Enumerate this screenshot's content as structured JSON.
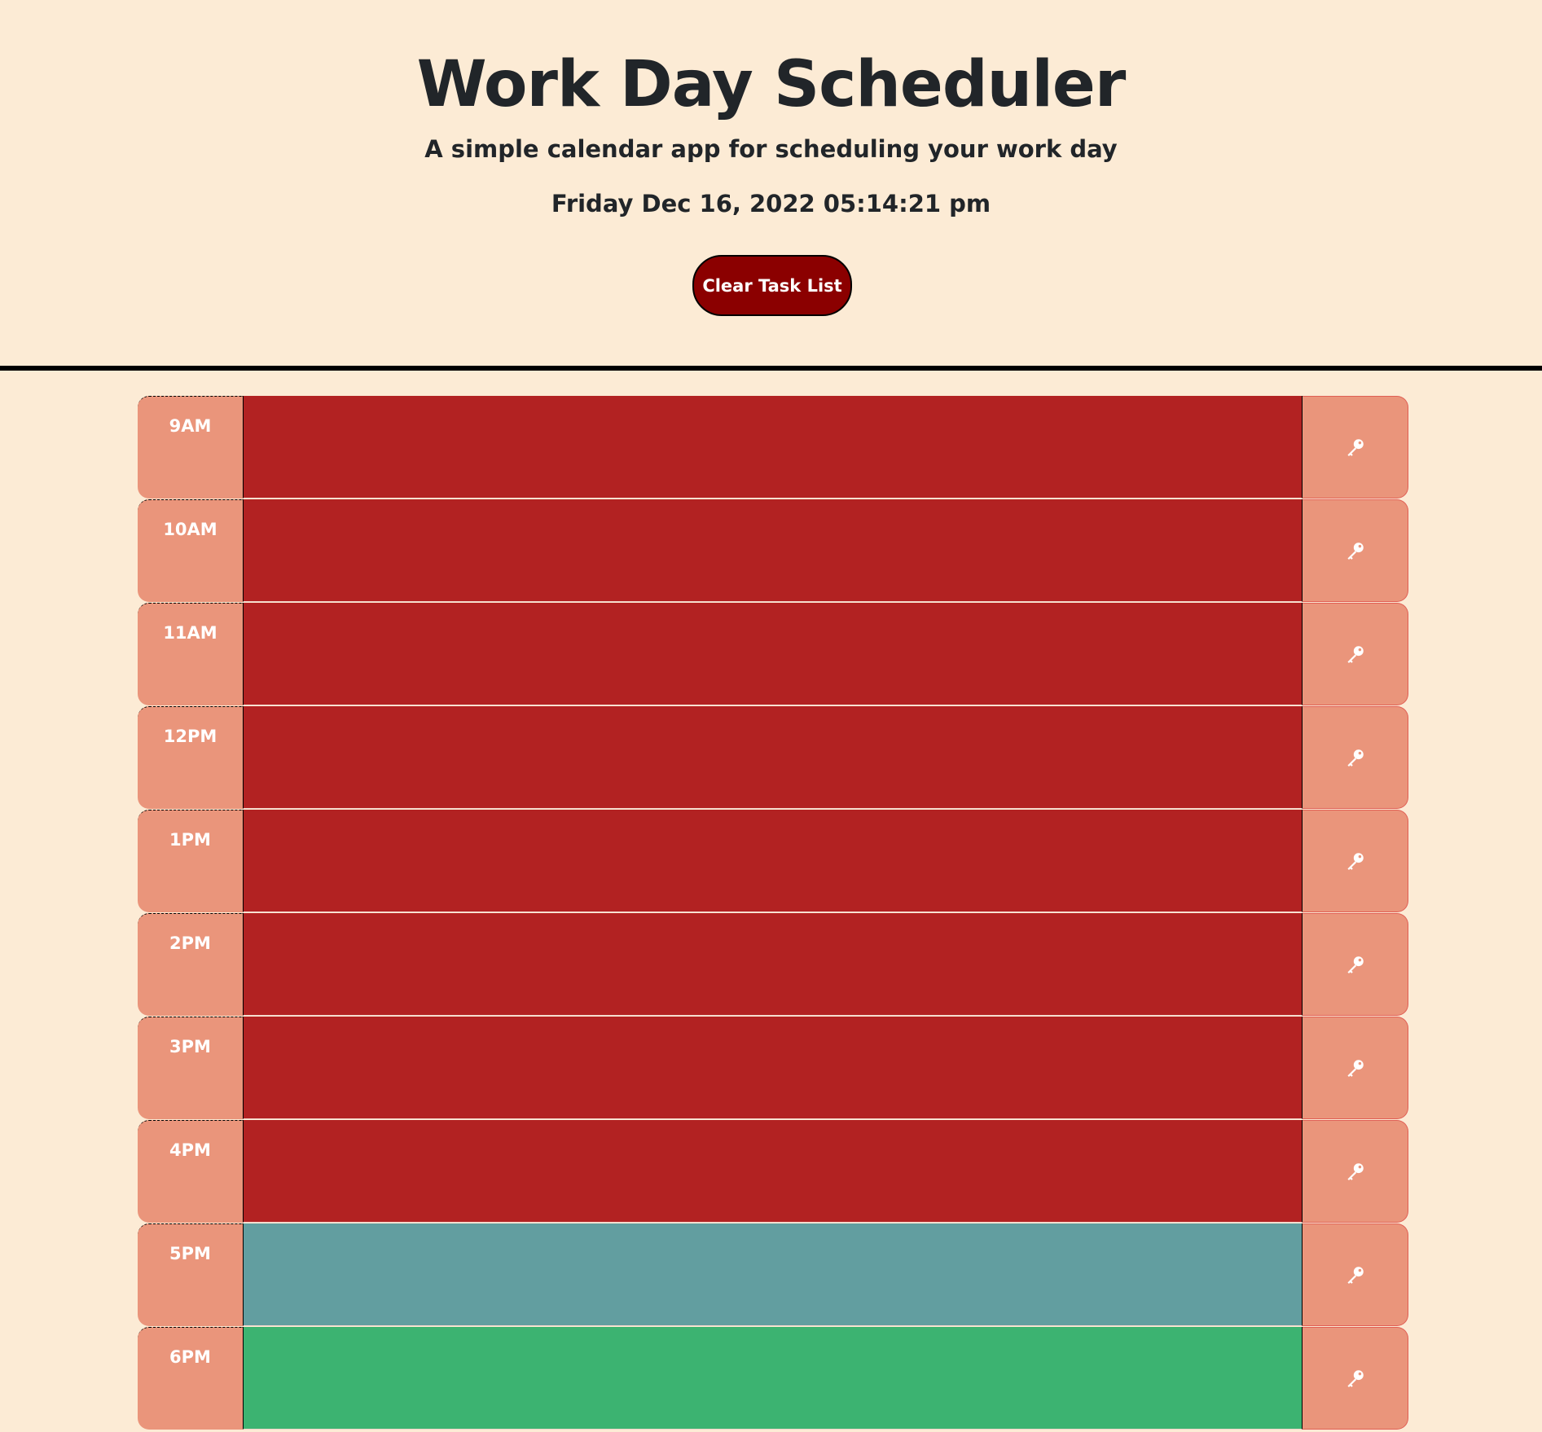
{
  "header": {
    "title": "Work Day Scheduler",
    "subtitle": "A simple calendar app for scheduling your work day",
    "current_day": "Friday Dec 16, 2022 05:14:21 pm",
    "clear_button_label": "Clear Task List"
  },
  "colors": {
    "background": "#fcebd5",
    "past": "#b22222",
    "present": "#629ea0",
    "future": "#3cb371",
    "hour_label_bg": "#ea957b",
    "clear_button_bg": "#8b0000"
  },
  "time_blocks": [
    {
      "hour": "9AM",
      "status": "past",
      "task": ""
    },
    {
      "hour": "10AM",
      "status": "past",
      "task": ""
    },
    {
      "hour": "11AM",
      "status": "past",
      "task": ""
    },
    {
      "hour": "12PM",
      "status": "past",
      "task": ""
    },
    {
      "hour": "1PM",
      "status": "past",
      "task": ""
    },
    {
      "hour": "2PM",
      "status": "past",
      "task": ""
    },
    {
      "hour": "3PM",
      "status": "past",
      "task": ""
    },
    {
      "hour": "4PM",
      "status": "past",
      "task": ""
    },
    {
      "hour": "5PM",
      "status": "present",
      "task": ""
    },
    {
      "hour": "6PM",
      "status": "future",
      "task": ""
    }
  ],
  "save_icon": "key-icon"
}
